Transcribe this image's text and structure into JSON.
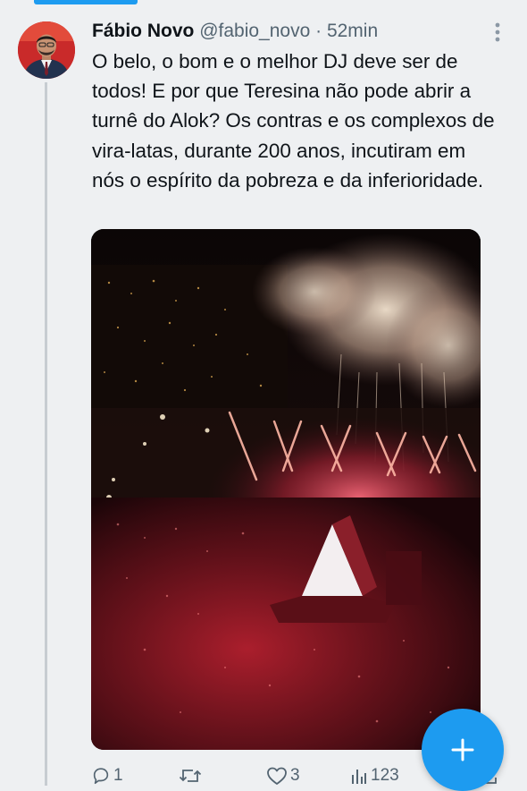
{
  "tweet": {
    "display_name": "Fábio Novo",
    "handle": "@fabio_novo",
    "separator": "·",
    "time": "52min",
    "text": "O belo, o bom e o melhor DJ deve ser de todos! E por que Teresina não pode abrir a turnê do Alok? Os contras e os complexos de vira-latas, durante 200 anos, incutiram em nós o espírito da pobreza e da inferioridade."
  },
  "actions": {
    "reply_count": "1",
    "retweet_count": "",
    "like_count": "3",
    "views_count": "123"
  },
  "icons": {
    "avatar": "avatar",
    "more": "more-vertical-icon",
    "reply": "reply-icon",
    "retweet": "retweet-icon",
    "like": "heart-icon",
    "views": "views-icon",
    "share": "share-icon",
    "compose": "plus-icon"
  },
  "colors": {
    "accent": "#1d9bf0",
    "text": "#0f1419",
    "secondary_text": "#536471",
    "background": "#eef0f2"
  }
}
